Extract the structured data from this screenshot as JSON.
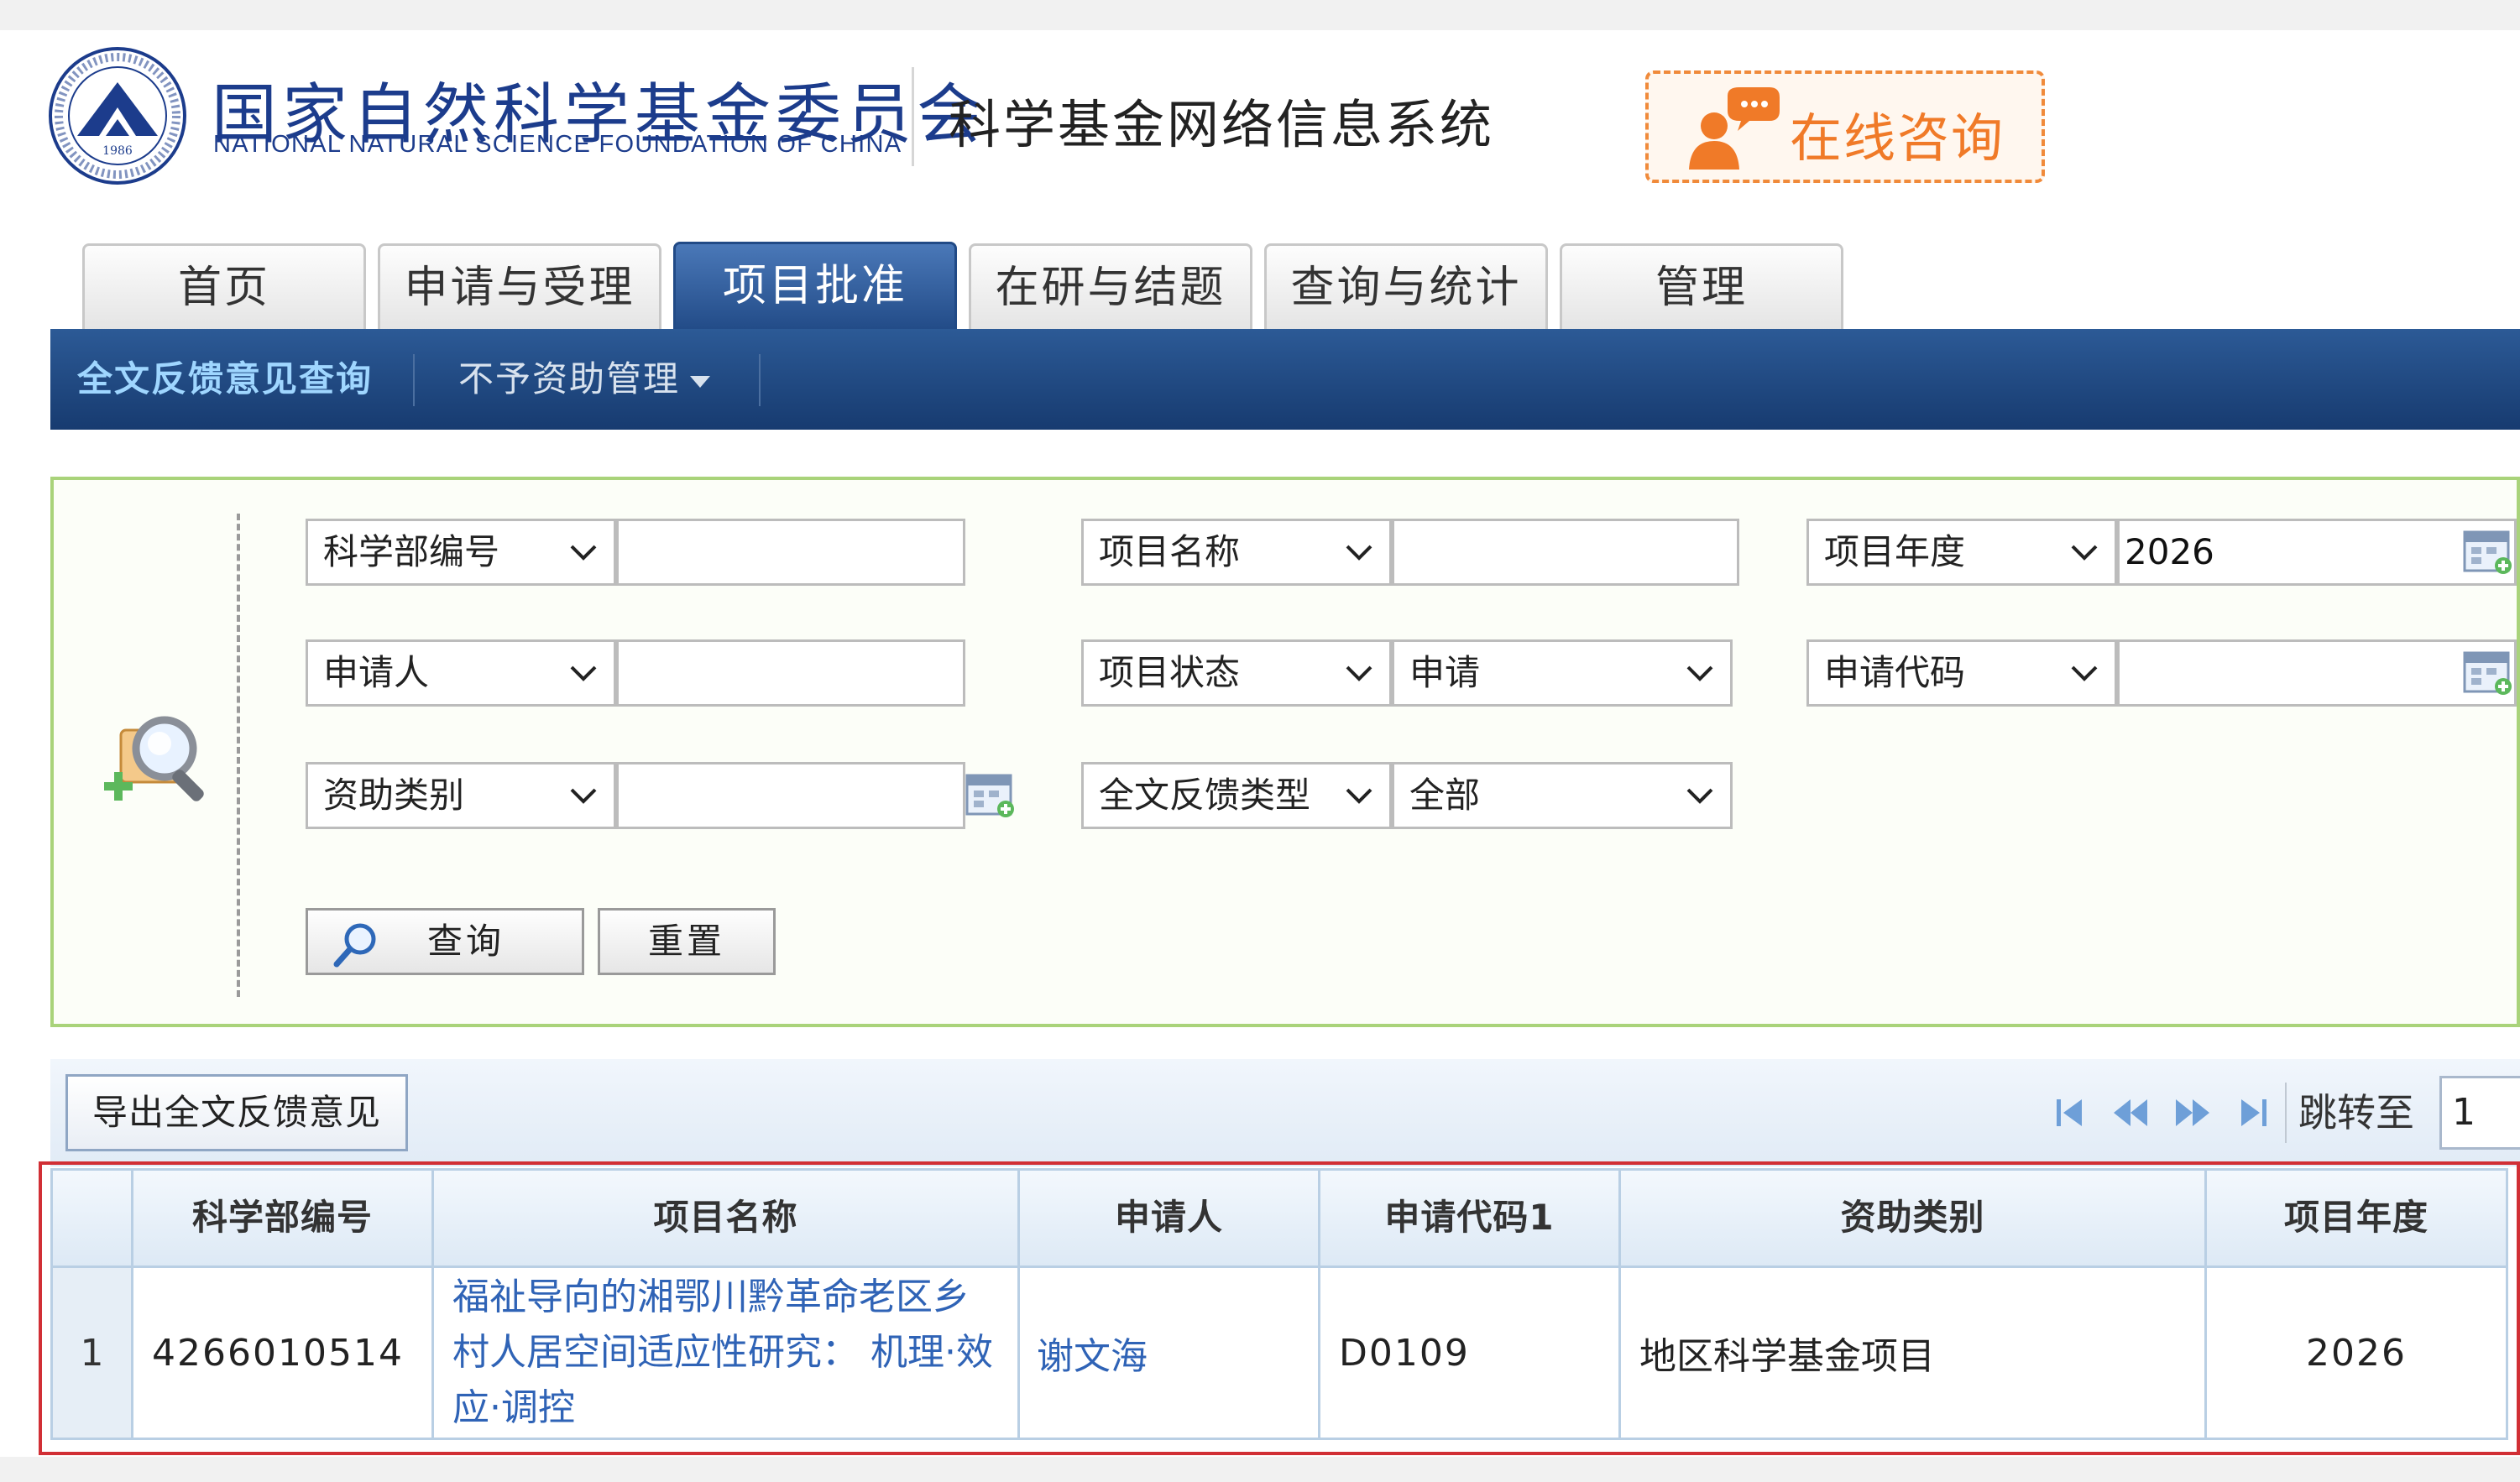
{
  "header": {
    "org_name_cn": "国家自然科学基金委员会",
    "org_name_en": "NATIONAL NATURAL SCIENCE FOUNDATION OF CHINA",
    "system_title": "科学基金网络信息系统",
    "consult_label": "在线咨询",
    "seal_year": "1986"
  },
  "nav": {
    "tabs": [
      {
        "label": "首页"
      },
      {
        "label": "申请与受理"
      },
      {
        "label": "项目批准"
      },
      {
        "label": "在研与结题"
      },
      {
        "label": "查询与统计"
      },
      {
        "label": "管理"
      }
    ],
    "active_tab": "项目批准",
    "subnav": {
      "fulltext_feedback": "全文反馈意见查询",
      "no_funding_mgmt": "不予资助管理"
    }
  },
  "search": {
    "row1": {
      "field1_select": "科学部编号",
      "field1_value": "",
      "field2_select": "项目名称",
      "field2_value": "",
      "field3_select": "项目年度",
      "field3_value": "2026"
    },
    "row2": {
      "field1_select": "申请人",
      "field1_value": "",
      "field2_select": "项目状态",
      "field2_value_select": "申请",
      "field3_select": "申请代码",
      "field3_value": ""
    },
    "row3": {
      "field1_select": "资助类别",
      "field1_value": "",
      "field2_select": "全文反馈类型",
      "field2_value_select": "全部"
    },
    "query_label": "查询",
    "reset_label": "重置"
  },
  "toolbar": {
    "export_label": "导出全文反馈意见",
    "jump_label": "跳转至",
    "jump_value": "1"
  },
  "table": {
    "columns": [
      "科学部编号",
      "项目名称",
      "申请人",
      "申请代码1",
      "资助类别",
      "项目年度"
    ],
    "rows": [
      {
        "index": "1",
        "dept_code": "4266010514",
        "project_name_lines": [
          "福祉导向的湘鄂川黔革命老区乡",
          "村人居空间适应性研究： 机理·效",
          "应·调控"
        ],
        "applicant": "谢文海",
        "apply_code": "D0109",
        "funding_type": "地区科学基金项目",
        "year": "2026"
      }
    ]
  },
  "colors": {
    "brand_blue": "#1c3c8c",
    "nav_blue": "#214a86",
    "consult_orange": "#f07a28",
    "panel_green": "#a9d37a",
    "highlight_red": "#d12f35",
    "link_blue": "#2f63b6"
  }
}
